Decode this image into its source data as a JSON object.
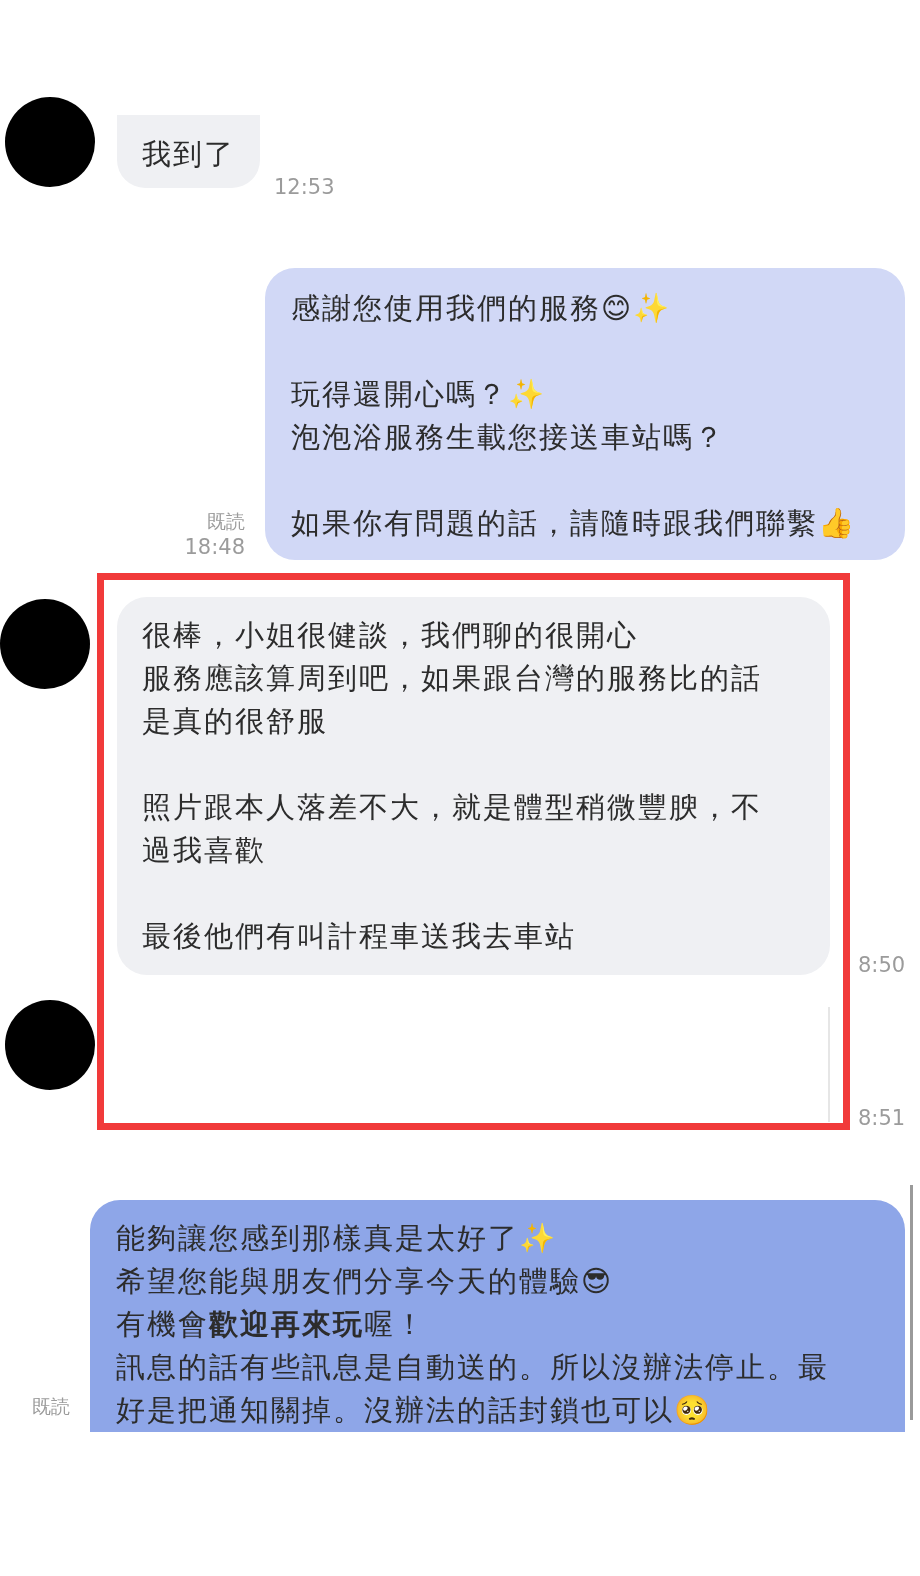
{
  "messages": [
    {
      "kind": "incoming",
      "paragraphs": [
        [
          {
            "text": "我到了"
          }
        ]
      ],
      "time": "12:53"
    },
    {
      "kind": "outgoing",
      "read": "既読",
      "time": "18:48",
      "paragraphs": [
        [
          {
            "text": "感謝您使用我們的服務😊✨"
          }
        ],
        [
          {
            "text": "玩得還開心嗎？✨"
          },
          {
            "text": "泡泡浴服務生載您接送車站嗎？"
          }
        ],
        [
          {
            "text": "如果你有問題的話，請隨時跟我們聯繫👍"
          }
        ]
      ]
    },
    {
      "kind": "incoming",
      "paragraphs": [
        [
          {
            "text": "很棒，小姐很健談，我們聊的很開心"
          },
          {
            "text": "服務應該算周到吧，如果跟台灣的服務比的話"
          },
          {
            "text": "是真的很舒服"
          }
        ],
        [
          {
            "text": "照片跟本人落差不大，就是體型稍微豐腴，不"
          },
          {
            "text": "過我喜歡"
          }
        ],
        [
          {
            "text": "最後他們有叫計程車送我去車站"
          }
        ]
      ],
      "time": "8:50"
    },
    {
      "kind": "blank",
      "time": "8:51"
    },
    {
      "kind": "reply",
      "read": "既読",
      "paragraphs": [
        [
          {
            "text": "能夠讓您感到那樣真是太好了✨"
          },
          {
            "text": "希望您能與朋友們分享今天的體驗😎"
          },
          {
            "text": "有機會**歡迎再來玩**喔！"
          },
          {
            "text": "訊息的話有些訊息是自動送的。所以沒辦法停止。最"
          },
          {
            "text": "好是把通知關掉。沒辦法的話封鎖也可以🥺"
          }
        ]
      ]
    }
  ]
}
